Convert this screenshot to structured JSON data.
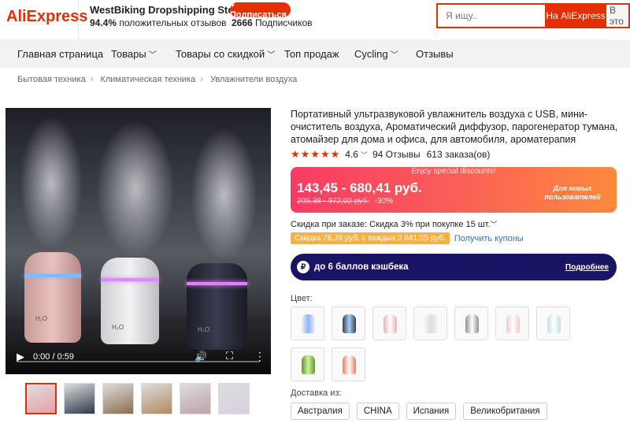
{
  "header": {
    "logo": "AliExpress",
    "store_name": "WestBiking Dropshipping Store",
    "positive_pct": "94.4%",
    "positive_text": "положительных отзывов",
    "subscribe_label": "+ Подписаться",
    "subscribers_count": "2666",
    "subscribers_text": "Подписчиков",
    "search_placeholder": "Я ищу..",
    "search_btn_aliexpress": "На AliExpress",
    "search_btn_store": "В это"
  },
  "nav": {
    "items": [
      {
        "label": "Главная страница",
        "chevron": false
      },
      {
        "label": "Товары",
        "chevron": true
      },
      {
        "label": "Товары со скидкой",
        "chevron": true
      },
      {
        "label": "Топ продаж",
        "chevron": false
      },
      {
        "label": "Cycling",
        "chevron": true
      },
      {
        "label": "Отзывы",
        "chevron": false
      }
    ]
  },
  "breadcrumb": [
    "Бытовая техника",
    "Климатическая техника",
    "Увлажнители воздуха"
  ],
  "video": {
    "time": "0:00 / 0:59",
    "progress": 0,
    "labels": [
      "H₂O",
      "H₂O",
      "H₂O"
    ]
  },
  "thumbnails": [
    {
      "name": "thumb-1",
      "selected": true,
      "color": "#e8a0a8"
    },
    {
      "name": "thumb-2",
      "selected": false,
      "color": "#2a3b4c"
    },
    {
      "name": "thumb-3",
      "selected": false,
      "color": "#8a6e50"
    },
    {
      "name": "thumb-4",
      "selected": false,
      "color": "#b08a60"
    },
    {
      "name": "thumb-5",
      "selected": false,
      "color": "#c0a0a8"
    },
    {
      "name": "thumb-6",
      "selected": false,
      "color": "#d8d0e0"
    }
  ],
  "product": {
    "title": "Портативный ультразвуковой увлажнитель воздуха с USB, мини-очиститель воздуха, Ароматический диффузор, парогенератор тумана, атомайзер для дома и офиса, для автомобиля, ароматерапия",
    "rating": "4.6",
    "stars": "★★★★★",
    "reviews": "94 Отзывы",
    "orders": "613 заказа(ов)"
  },
  "price": {
    "promo_top": "Enjoy special discounts!",
    "range": "143,45 - 680,41 руб.",
    "old_range": "205,38 - 972,02 руб.",
    "discount": "-30%",
    "new_users": "Для новых пользователей"
  },
  "discount_line": "Скидка при заказе: Скидка 3% при покупке 15 шт.",
  "coupon": {
    "text": "Скидка 78,39 руб. с каждых 3 841,05 руб.",
    "link": "Получить купоны"
  },
  "cashback": {
    "icon": "₽",
    "text": "до 6 баллов кэшбека",
    "more": "Подробнее"
  },
  "color_label": "Цвет:",
  "swatches": [
    {
      "name": "swatch-white-multi",
      "color": "#f0f0f0",
      "accent": "#8ab8ff"
    },
    {
      "name": "swatch-dark-gray",
      "color": "#3c4048",
      "accent": "#a0d0ff"
    },
    {
      "name": "swatch-pink",
      "color": "#eab0b4",
      "accent": "#ffffff"
    },
    {
      "name": "swatch-white",
      "color": "#f4f4f4",
      "accent": "#dddddd"
    },
    {
      "name": "swatch-gray",
      "color": "#8f9096",
      "accent": "#ffffff"
    },
    {
      "name": "swatch-light-pink",
      "color": "#f6c8c6",
      "accent": "#ffffff"
    },
    {
      "name": "swatch-clear-blue",
      "color": "#c8dcf0",
      "accent": "#ffffff"
    },
    {
      "name": "swatch-green",
      "color": "#5c9a2a",
      "accent": "#d0f0a0"
    },
    {
      "name": "swatch-orange",
      "color": "#f07a5a",
      "accent": "#ffffff"
    }
  ],
  "shipping": {
    "label": "Доставка из:",
    "options": [
      "Австралия",
      "CHINA",
      "Испания",
      "Великобритания"
    ]
  }
}
